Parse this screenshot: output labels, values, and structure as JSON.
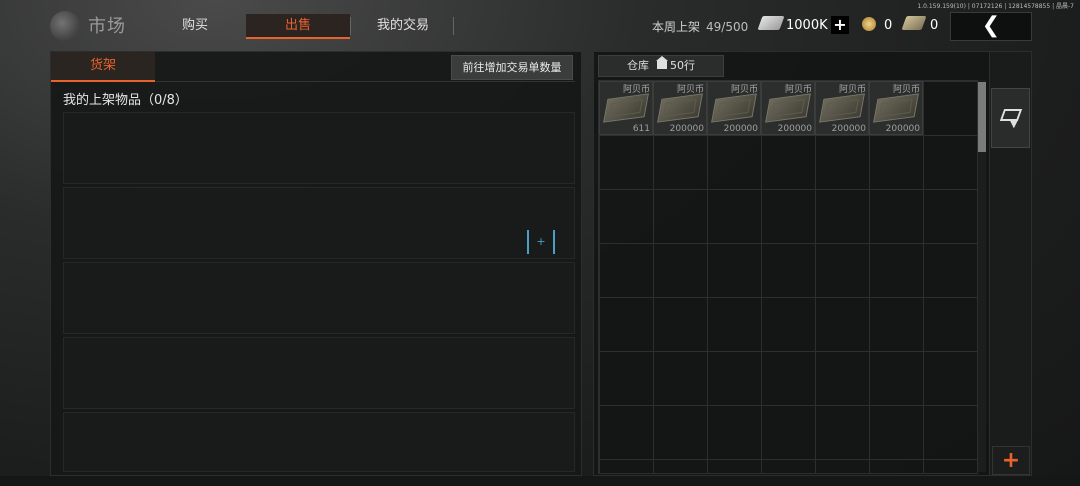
{
  "build_info": "1.0.159.159(10) | 07172126 | 12814578855 | 晶晨-7",
  "header": {
    "title": "市场",
    "tabs": [
      {
        "label": "购买",
        "active": false
      },
      {
        "label": "出售",
        "active": true
      },
      {
        "label": "我的交易",
        "active": false
      }
    ],
    "weekly_label": "本周上架",
    "weekly_count": "49/500",
    "currency_cash": "1000K",
    "add_label": "+",
    "currency_coin": "0",
    "currency_bill": "0",
    "back_icon": "chevron-left-icon",
    "accent_color": "#e8622c"
  },
  "left": {
    "shelf_tab": "货架",
    "add_orders_button": "前往增加交易单数量",
    "my_listings": "我的上架物品（0/8）",
    "add_slot_label": "+"
  },
  "right": {
    "warehouse_label": "仓库",
    "warehouse_rows": "50行",
    "items": [
      {
        "name": "阿贝币",
        "qty": "611"
      },
      {
        "name": "阿贝币",
        "qty": "200000"
      },
      {
        "name": "阿贝币",
        "qty": "200000"
      },
      {
        "name": "阿贝币",
        "qty": "200000"
      },
      {
        "name": "阿贝币",
        "qty": "200000"
      },
      {
        "name": "阿贝币",
        "qty": "200000"
      }
    ],
    "add_row_label": "+"
  }
}
